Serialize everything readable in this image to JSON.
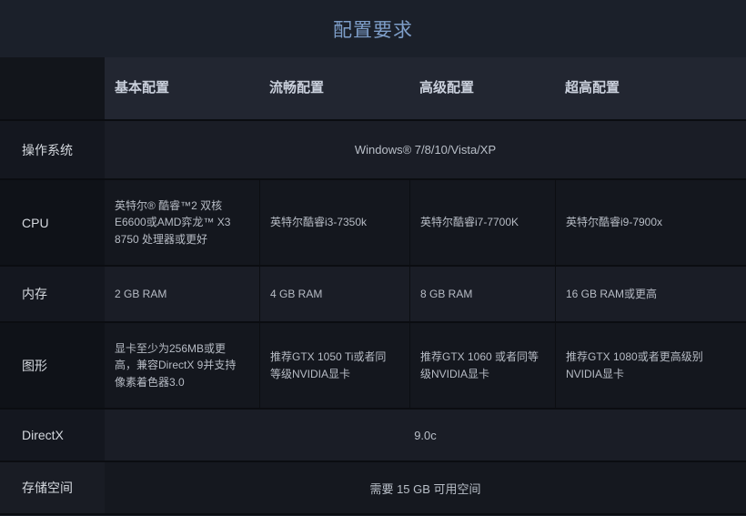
{
  "title": "配置要求",
  "columns": [
    "基本配置",
    "流畅配置",
    "高级配置",
    "超高配置"
  ],
  "row_labels": {
    "os": "操作系统",
    "cpu": "CPU",
    "ram": "内存",
    "gpu": "图形",
    "directx": "DirectX",
    "storage": "存储空间"
  },
  "rows": {
    "os": {
      "merged": "Windows® 7/8/10/Vista/XP"
    },
    "cpu": {
      "cells": [
        "英特尔® 酷睿™2 双核 E6600或AMD弈龙™ X3 8750 处理器或更好",
        "英特尔酷睿i3-7350k",
        "英特尔酷睿i7-7700K",
        "英特尔酷睿i9-7900x"
      ]
    },
    "ram": {
      "cells": [
        "2 GB RAM",
        "4 GB RAM",
        "8 GB RAM",
        "16 GB RAM或更高"
      ]
    },
    "gpu": {
      "cells": [
        "显卡至少为256MB或更高，兼容DirectX 9并支持像素着色器3.0",
        "推荐GTX 1050 Ti或者同等级NVIDIA显卡",
        "推荐GTX 1060 或者同等级NVIDIA显卡",
        "推荐GTX 1080或者更高级别NVIDIA显卡"
      ]
    },
    "directx": {
      "merged": "9.0c"
    },
    "storage": {
      "merged": "需要 15 GB 可用空间"
    }
  },
  "colors": {
    "page_background": "#1b202a",
    "title_text": "#7e9ec9",
    "header_cells_background": "#222631",
    "row_light_background": "#1a1d26",
    "row_dark_background": "#14171e",
    "body_text": "#b7bcc5"
  }
}
